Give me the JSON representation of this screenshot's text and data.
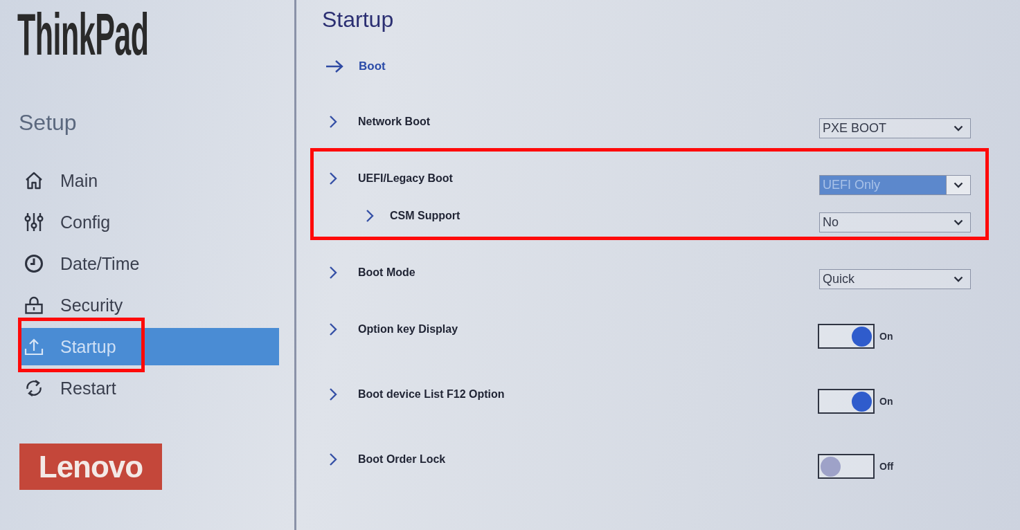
{
  "sidebar": {
    "logo": "ThinkPad",
    "heading": "Setup",
    "items": [
      {
        "label": "Main",
        "selected": false,
        "marked": false
      },
      {
        "label": "Config",
        "selected": false,
        "marked": false
      },
      {
        "label": "Date/Time",
        "selected": false,
        "marked": false
      },
      {
        "label": "Security",
        "selected": false,
        "marked": false
      },
      {
        "label": "Startup",
        "selected": true,
        "marked": true
      },
      {
        "label": "Restart",
        "selected": false,
        "marked": false
      }
    ],
    "brand": "Lenovo"
  },
  "page": {
    "title": "Startup",
    "section": "Boot",
    "settings": [
      {
        "label": "Network Boot",
        "kind": "dropdown",
        "value": "PXE BOOT",
        "focused": false,
        "marked": false
      },
      {
        "label": "UEFI/Legacy Boot",
        "kind": "dropdown",
        "value": "UEFI Only",
        "focused": true,
        "marked": true,
        "children": [
          {
            "label": "CSM Support",
            "kind": "dropdown",
            "value": "No",
            "focused": false
          }
        ]
      },
      {
        "label": "Boot Mode",
        "kind": "dropdown",
        "value": "Quick",
        "focused": false,
        "marked": false
      },
      {
        "label": "Option key Display",
        "kind": "toggle",
        "on": true,
        "value": "On",
        "marked": false
      },
      {
        "label": "Boot device List F12 Option",
        "kind": "toggle",
        "on": true,
        "value": "On",
        "marked": false
      },
      {
        "label": "Boot Order Lock",
        "kind": "toggle",
        "on": false,
        "value": "Off",
        "marked": false
      }
    ]
  }
}
